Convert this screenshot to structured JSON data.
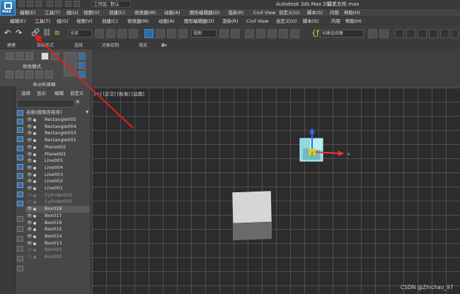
{
  "title_bar": {
    "workspace_label": "工作区: 默认",
    "app_name": "Autodesk 3ds Max 2017",
    "file_name": "窗式衣柜.max"
  },
  "menu_primary": [
    "编辑(E)",
    "工具(T)",
    "组(G)",
    "视图(V)",
    "创建(C)",
    "修改器(M)",
    "动画(A)",
    "图形编辑器(D)",
    "渲染(R)",
    "Civil View",
    "自定义(U)",
    "脚本(S)",
    "内容",
    "帮助(H)"
  ],
  "menu_secondary": [
    "编辑(E)",
    "工具(T)",
    "组(G)",
    "视图(V)",
    "创建(C)",
    "修改器(M)",
    "动画(A)",
    "图形编辑器(D)",
    "渲染(R)",
    "Civil View",
    "自定义(U)",
    "脚本(S)",
    "内容",
    "帮助(H)"
  ],
  "toolbar": {
    "selection_filter": "全部",
    "ref_coord": "视图",
    "named_selection": "创建选择集"
  },
  "ribbon": {
    "tabs": [
      "建模",
      "自由形式",
      "选择",
      "对象绘制",
      "填充"
    ],
    "mode_label": "修改模式",
    "poly_label": "多边形建模"
  },
  "scene_explorer": {
    "tabs": [
      "选择",
      "显示",
      "编辑",
      "自定义"
    ],
    "header": "名称(按降序排序)",
    "rows": [
      {
        "name": "Rectangle005",
        "state": "normal"
      },
      {
        "name": "Rectangle004",
        "state": "normal"
      },
      {
        "name": "Rectangle003",
        "state": "normal"
      },
      {
        "name": "Rectangle001",
        "state": "normal"
      },
      {
        "name": "Plane002",
        "state": "normal"
      },
      {
        "name": "Plane001",
        "state": "normal"
      },
      {
        "name": "Line005",
        "state": "normal"
      },
      {
        "name": "Line004",
        "state": "normal"
      },
      {
        "name": "Line003",
        "state": "normal"
      },
      {
        "name": "Line002",
        "state": "normal"
      },
      {
        "name": "Line001",
        "state": "normal"
      },
      {
        "name": "Cylinder002",
        "state": "hidden"
      },
      {
        "name": "Cylinder001",
        "state": "hidden"
      },
      {
        "name": "Box018",
        "state": "selected"
      },
      {
        "name": "Box017",
        "state": "normal"
      },
      {
        "name": "Box016",
        "state": "normal"
      },
      {
        "name": "Box015",
        "state": "normal"
      },
      {
        "name": "Box014",
        "state": "normal"
      },
      {
        "name": "Box013",
        "state": "normal"
      },
      {
        "name": "Box003",
        "state": "hidden"
      },
      {
        "name": "Box002",
        "state": "hidden"
      }
    ]
  },
  "viewport": {
    "label": "[+] [正交] [标准] [边面]",
    "gizmo_axis_label": "x"
  },
  "watermark": "CSDN @Zhichao_97",
  "colors": {
    "accent": "#2b6da8",
    "annotation_arrow": "#e02020",
    "selection_cube": "#8fd8e0"
  }
}
